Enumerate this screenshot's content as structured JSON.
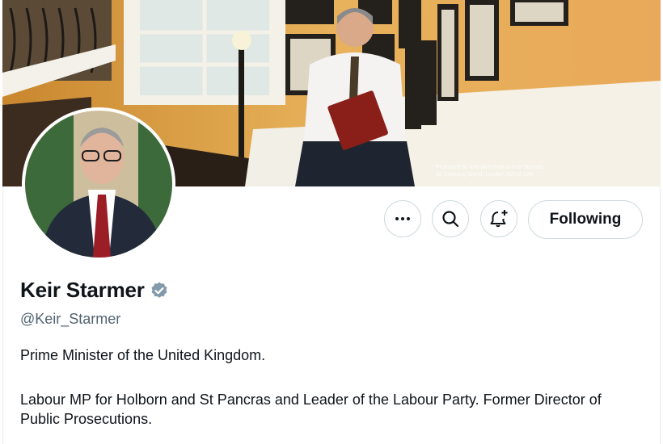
{
  "banner": {
    "promoted_line1": "Promoted by and on behalf of Keir Starmer,",
    "promoted_line2": "10 Downing Street, London SW1A 2AA"
  },
  "profile": {
    "display_name": "Keir Starmer",
    "handle": "@Keir_Starmer",
    "bio_line1": "Prime Minister of the United Kingdom.",
    "bio_line2": "Labour MP for Holborn and St Pancras and Leader of the Labour Party. Former Director of Public Prosecutions.",
    "verified_color": "#829aab"
  },
  "actions": {
    "more_icon": "more-icon",
    "search_icon": "search-icon",
    "notify_icon": "bell-plus-icon",
    "follow_label": "Following"
  }
}
